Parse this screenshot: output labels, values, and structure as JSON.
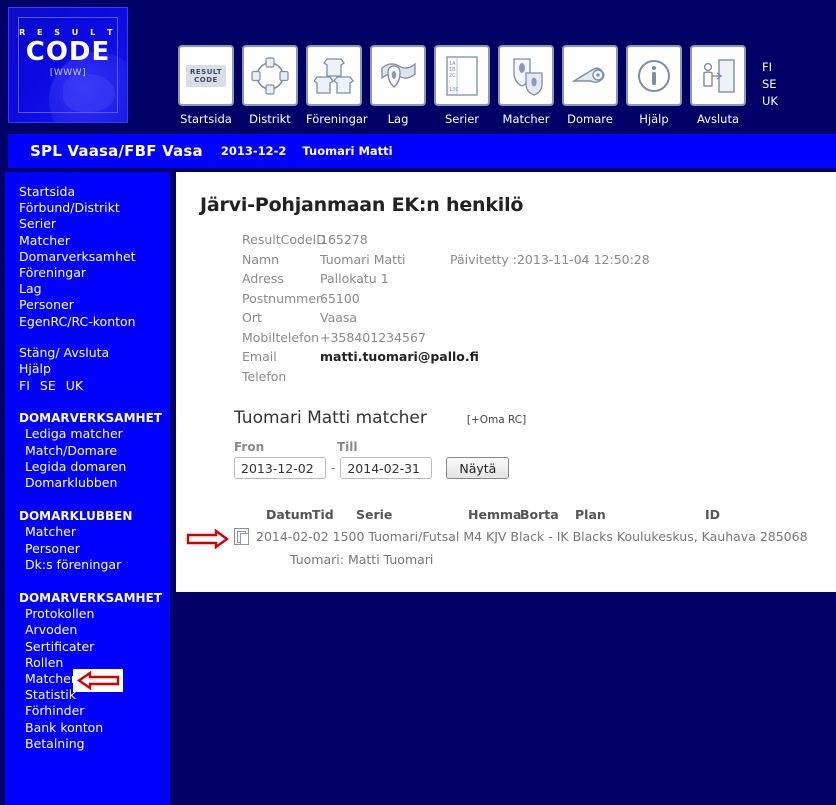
{
  "logo": {
    "result_text": "R E S U L T",
    "code_text": "CODE",
    "www_text": "[WWW]"
  },
  "toolbar": {
    "items": [
      {
        "label": "Startsida",
        "icon": "resultcode-logo-icon"
      },
      {
        "label": "Distrikt",
        "icon": "people-network-icon"
      },
      {
        "label": "Föreningar",
        "icon": "shirts-group-icon"
      },
      {
        "label": "Lag",
        "icon": "flag-shield-icon"
      },
      {
        "label": "Serier",
        "icon": "list-document-icon"
      },
      {
        "label": "Matcher",
        "icon": "two-shields-icon"
      },
      {
        "label": "Domare",
        "icon": "whistle-icon"
      },
      {
        "label": "Hjälp",
        "icon": "info-circle-icon"
      },
      {
        "label": "Avsluta",
        "icon": "exit-door-icon"
      }
    ],
    "languages": [
      "FI",
      "SE",
      "UK"
    ]
  },
  "titlebar": {
    "organization": "SPL Vaasa/FBF Vasa",
    "date": "2013-12-2",
    "user": "Tuomari Matti"
  },
  "sidebar": {
    "primary_links": [
      "Startsida",
      "Förbund/Distrikt",
      "Serier",
      "Matcher",
      "Domarverksamhet",
      "Föreningar",
      "Lag",
      "Personer",
      "EgenRC/RC-konton"
    ],
    "secondary_links": [
      "Stäng/ Avsluta",
      "Hjälp"
    ],
    "languages": [
      "FI",
      "SE",
      "UK"
    ],
    "groups": [
      {
        "heading": "DOMARVERKSAMHET",
        "items": [
          "Lediga matcher",
          "Match/Domare",
          "Legida domaren",
          "Domarklubben"
        ]
      },
      {
        "heading": "DOMARKLUBBEN",
        "items": [
          "Matcher",
          "Personer",
          "Dk:s föreningar"
        ]
      },
      {
        "heading": "DOMARVERKSAMHET",
        "items": [
          "Protokollen",
          "Arvoden",
          "Sertificater",
          "Rollen",
          "Matcher",
          "Statistik",
          "Förhinder",
          "Bank konton",
          "Betalning"
        ]
      }
    ]
  },
  "main": {
    "page_title": "Järvi-Pohjanmaan EK:n henkilö",
    "details": [
      {
        "label": "ResultCodeID",
        "value": "165278",
        "extra": ""
      },
      {
        "label": "Namn",
        "value": "Tuomari Matti",
        "extra": "Päivitetty :2013-11-04 12:50:28"
      },
      {
        "label": "Adress",
        "value": "Pallokatu 1",
        "extra": ""
      },
      {
        "label": "Postnummer",
        "value": "65100",
        "extra": ""
      },
      {
        "label": "Ort",
        "value": "Vaasa",
        "extra": ""
      },
      {
        "label": "Mobiltelefon",
        "value": "+358401234567",
        "extra": ""
      },
      {
        "label": "Email",
        "value": "matti.tuomari@pallo.fi",
        "extra": "",
        "bold": true
      },
      {
        "label": "Telefon",
        "value": "",
        "extra": ""
      }
    ],
    "matcher": {
      "title": "Tuomari Matti matcher",
      "oma_rc_link": "[+Oma RC]",
      "from_label": "Fron",
      "till_label": "Till",
      "from_value": "2013-12-02",
      "till_value": "2014-02-31",
      "separator": "-",
      "show_button": "Näytä"
    },
    "results": {
      "columns": {
        "datum": "Datum",
        "tid": "Tid",
        "serie": "Serie",
        "hemma": "Hemma",
        "borta": "Borta",
        "plan": "Plan",
        "id": "ID"
      },
      "row_text": "2014-02-02 1500  Tuomari/Futsal M4 KJV Black - IK Blacks Koulukeskus, Kauhava 285068",
      "row_subtext": "Tuomari: Matti Tuomari",
      "row_icon": "document-copy-icon"
    }
  },
  "annotations": {
    "sidebar_arrow": "red-left-arrow-icon",
    "row_arrow": "red-right-arrow-icon"
  },
  "colors": {
    "page_background": "#000066",
    "panel_blue": "#0000FF",
    "content_white": "#FFFFFF",
    "annotation_red": "#CC0000"
  }
}
